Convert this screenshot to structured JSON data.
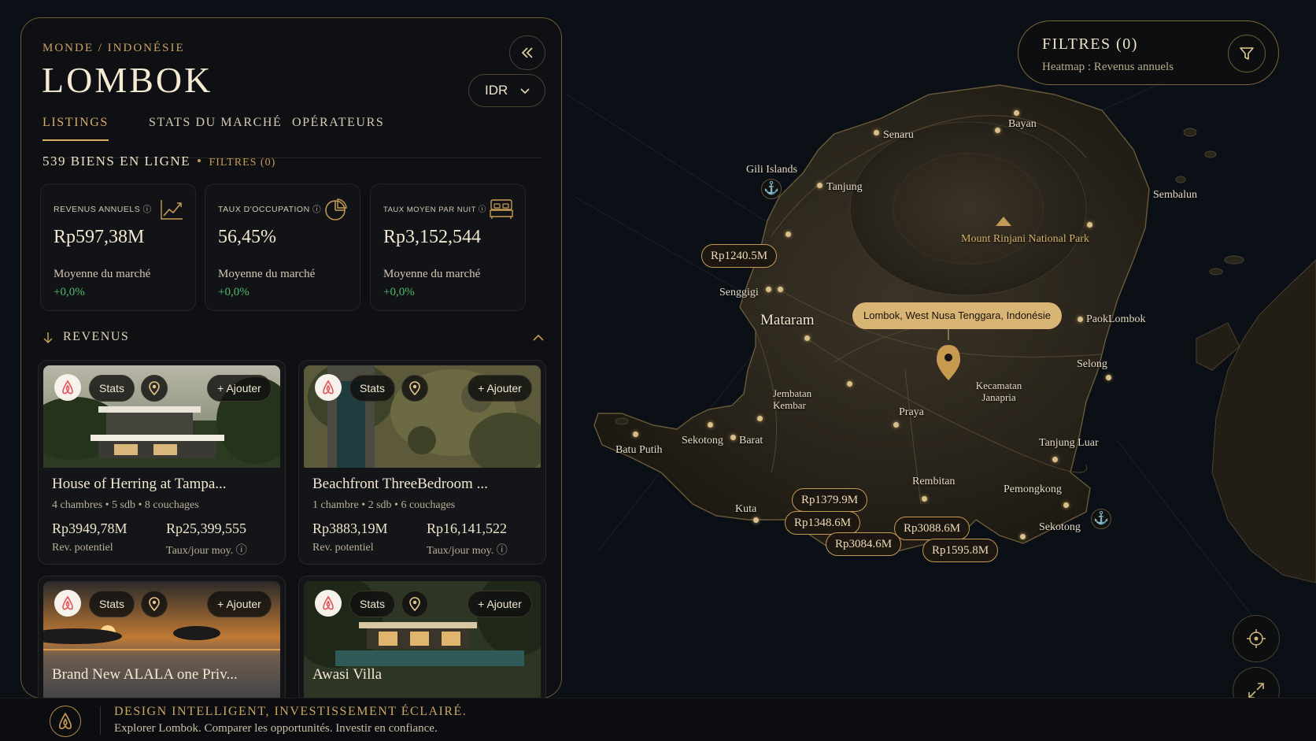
{
  "breadcrumb": "MONDE / INDONÉSIE",
  "title": "LOMBOK",
  "currency": "IDR",
  "tabs": [
    "LISTINGS",
    "STATS DU MARCHÉ",
    "OPÉRATEURS"
  ],
  "count_label": "539 BIENS EN LIGNE",
  "count_filters": "FILTRES (0)",
  "stats": [
    {
      "label": "REVENUS ANNUELS",
      "value": "Rp597,38M",
      "sub": "Moyenne du marché",
      "change": "+0,0%",
      "icon": "line-chart-icon"
    },
    {
      "label": "TAUX D'OCCUPATION",
      "value": "56,45%",
      "sub": "Moyenne du marché",
      "change": "+0,0%",
      "icon": "pie-chart-icon"
    },
    {
      "label": "TAUX MOYEN PAR NUIT",
      "value": "Rp3,152,544",
      "sub": "Moyenne du marché",
      "change": "+0,0%",
      "icon": "bed-icon"
    }
  ],
  "section_label": "REVENUS",
  "card_buttons": {
    "stats": "Stats",
    "add": "+ Ajouter"
  },
  "listings": [
    {
      "name": "House of Herring at Tampa...",
      "meta": "4 chambres • 5 sdb • 8 couchages",
      "potential": "Rp3949,78M",
      "potential_label": "Rev. potentiel",
      "rate": "Rp25,399,555",
      "rate_label": "Taux/jour moy."
    },
    {
      "name": "Beachfront ThreeBedroom ...",
      "meta": "1 chambre • 2 sdb • 6 couchages",
      "potential": "Rp3883,19M",
      "potential_label": "Rev. potentiel",
      "rate": "Rp16,141,522",
      "rate_label": "Taux/jour moy."
    },
    {
      "name": "Brand New ALALA one Priv..."
    },
    {
      "name": "Awasi Villa"
    }
  ],
  "filters_panel": {
    "title": "FILTRES (0)",
    "subtitle": "Heatmap : Revenus annuels"
  },
  "map": {
    "tooltip": "Lombok, West Nusa Tenggara, Indonésie",
    "places": [
      "Senaru",
      "Bayan",
      "Gili Islands",
      "Tanjung",
      "Sembalun",
      "Senggigi",
      "Mataram",
      "PaokLombok",
      "Selong",
      "Kecamatan Janapria",
      "Jembatan Kembar",
      "Praya",
      "Batu Putih",
      "Sekotong",
      "Barat",
      "Tanjung Luar",
      "Rembitan",
      "Pemongkong",
      "Kuta",
      "Sekotong"
    ],
    "park": "Mount Rinjani National Park",
    "prices": [
      "Rp1240.5M",
      "Rp1379.9M",
      "Rp1348.6M",
      "Rp3084.6M",
      "Rp3088.6M",
      "Rp1595.8M"
    ]
  },
  "footer": {
    "title": "DESIGN INTELLIGENT, INVESTISSEMENT ÉCLAIRÉ.",
    "subtitle": "Explorer Lombok. Comparer les opportunités. Investir en confiance."
  },
  "colors": {
    "accent": "#d8ad63",
    "positive": "#4fb96b",
    "background": "#0a0e14"
  }
}
